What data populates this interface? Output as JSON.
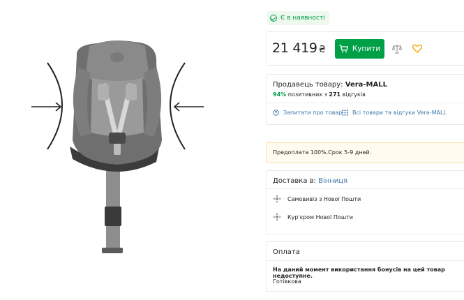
{
  "product": {
    "image_alt": "car-seat-photo"
  },
  "stock": {
    "label": "Є в наявності"
  },
  "price": {
    "amount": "21 419",
    "currency": "₴"
  },
  "buy": {
    "label": "Купити"
  },
  "seller": {
    "prefix": "Продавець товару:",
    "name": "Vera-MALL",
    "rating_pct": "94%",
    "rating_mid": "позитивних з",
    "rating_count": "271",
    "rating_suffix": "відгуків",
    "ask_label": "Запитати про товар",
    "all_label": "Всі товари та відгуки Vera-MALL"
  },
  "prepay": {
    "text": "Предоплата 100%.Срок 5-9 дней."
  },
  "delivery": {
    "prefix": "Доставка в:",
    "city": "Вінниця",
    "options": [
      {
        "label": "Самовивіз з Нової Пошти"
      },
      {
        "label": "Кур'єром Нової Пошти"
      }
    ]
  },
  "payment": {
    "title": "Оплата",
    "bonus_note": "На даний момент використання бонусів на цей товар недоступне.",
    "method": "Готівкова"
  },
  "colors": {
    "accent_green": "#00a046",
    "link_blue": "#3e77aa",
    "heart_yellow": "#f8a600"
  }
}
